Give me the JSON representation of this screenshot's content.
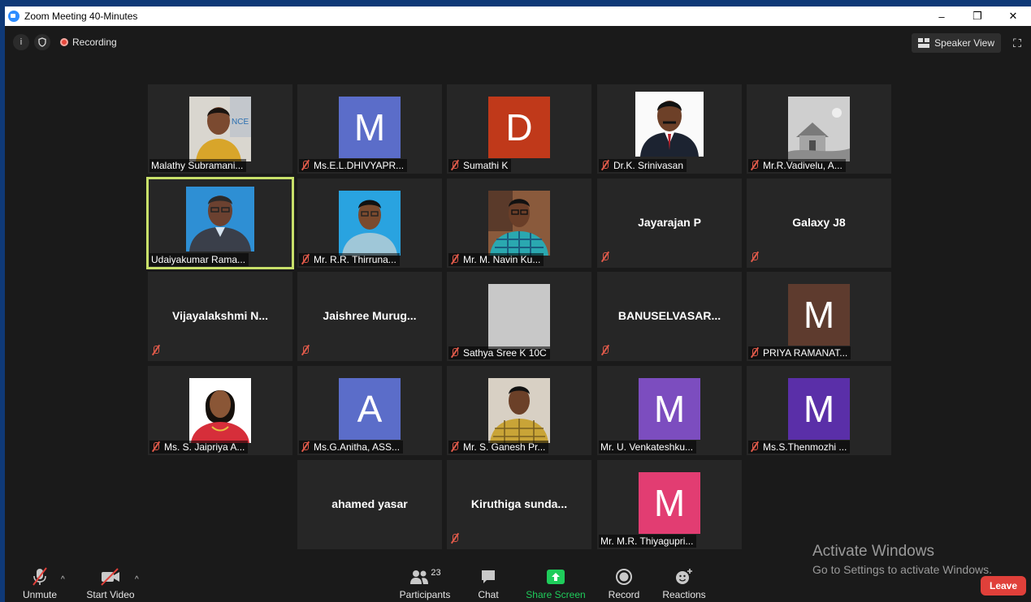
{
  "window": {
    "title": "Zoom Meeting 40-Minutes",
    "controls": [
      "–",
      "❐",
      "✕"
    ]
  },
  "topbar": {
    "info_icon": "i",
    "shield_icon": "shield",
    "recording_label": "Recording",
    "speaker_view_label": "Speaker View"
  },
  "tiles": [
    {
      "name": "Malathy Subramani...",
      "muted": false,
      "kind": "photo",
      "photo": "woman-yellow"
    },
    {
      "name": "Ms.E.L.DHIVYAPR...",
      "muted": true,
      "kind": "avatar",
      "letter": "M",
      "color": "#5b6dc9"
    },
    {
      "name": "Sumathi K",
      "muted": true,
      "kind": "avatar",
      "letter": "D",
      "color": "#c0391a"
    },
    {
      "name": "Dr.K. Srinivasan",
      "muted": true,
      "kind": "photo",
      "photo": "man-suit-white"
    },
    {
      "name": "Mr.R.Vadivelu, A...",
      "muted": true,
      "kind": "photo",
      "photo": "sketch-house"
    },
    {
      "name": "Udaiyakumar Rama...",
      "muted": false,
      "kind": "photo",
      "photo": "man-suit-blue",
      "active": true
    },
    {
      "name": "Mr. R.R. Thirruna...",
      "muted": true,
      "kind": "photo",
      "photo": "man-blue-bg"
    },
    {
      "name": "Mr. M. Navin Ku...",
      "muted": true,
      "kind": "photo",
      "photo": "man-check-shirt"
    },
    {
      "name": "Jayarajan P",
      "muted": true,
      "kind": "text"
    },
    {
      "name": "Galaxy J8",
      "muted": true,
      "kind": "text"
    },
    {
      "name": "Vijayalakshmi  N...",
      "muted": true,
      "kind": "text"
    },
    {
      "name": "Jaishree  Murug...",
      "muted": true,
      "kind": "text"
    },
    {
      "name": "Sathya Sree K 10C",
      "muted": true,
      "kind": "photo",
      "photo": "blank-grey"
    },
    {
      "name": "BANUSELVASAR...",
      "muted": true,
      "kind": "text"
    },
    {
      "name": "PRIYA RAMANAT...",
      "muted": true,
      "kind": "avatar",
      "letter": "M",
      "color": "#5e3b2e"
    },
    {
      "name": "Ms. S. Jaipriya A...",
      "muted": true,
      "kind": "photo",
      "photo": "woman-red"
    },
    {
      "name": "Ms.G.Anitha, ASS...",
      "muted": true,
      "kind": "avatar",
      "letter": "A",
      "color": "#5b6dc9"
    },
    {
      "name": "Mr. S. Ganesh Pr...",
      "muted": true,
      "kind": "photo",
      "photo": "man-yellow-shirt"
    },
    {
      "name": "Mr. U. Venkateshku...",
      "muted": false,
      "kind": "avatar",
      "letter": "M",
      "color": "#7c4dbf"
    },
    {
      "name": "Ms.S.Thenmozhi ...",
      "muted": true,
      "kind": "avatar",
      "letter": "M",
      "color": "#5a2fa8"
    },
    {
      "name": "ahamed yasar",
      "muted": false,
      "kind": "text"
    },
    {
      "name": "Kiruthiga  sunda...",
      "muted": true,
      "kind": "text"
    },
    {
      "name": "Mr. M.R. Thiyagupri...",
      "muted": false,
      "kind": "avatar",
      "letter": "M",
      "color": "#e23d72"
    }
  ],
  "toolbar": {
    "unmute": "Unmute",
    "start_video": "Start Video",
    "participants": "Participants",
    "participants_count": "23",
    "chat": "Chat",
    "share_screen": "Share Screen",
    "record": "Record",
    "reactions": "Reactions",
    "leave": "Leave",
    "share_color": "#1fcc5b"
  },
  "watermark": {
    "line1": "Activate Windows",
    "line2": "Go to Settings to activate Windows."
  }
}
